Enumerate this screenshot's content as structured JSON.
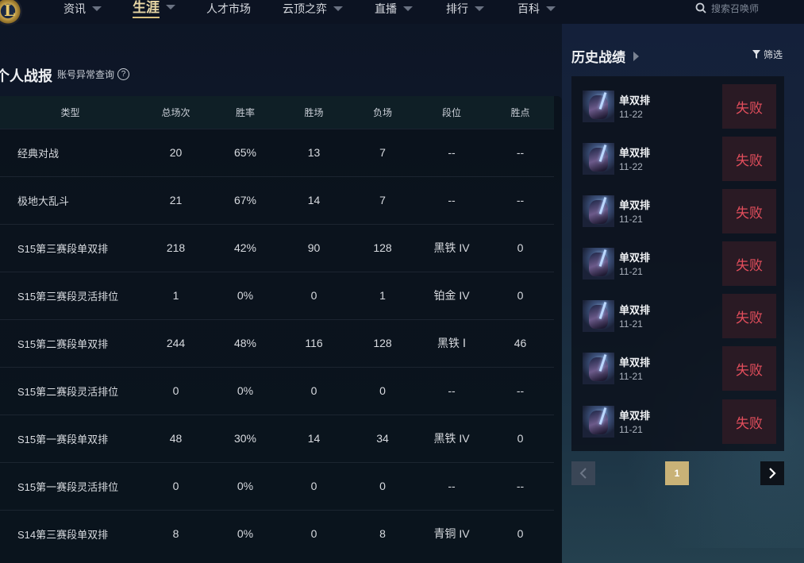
{
  "nav": {
    "items": [
      {
        "label": "资讯",
        "has_caret": true
      },
      {
        "label": "生涯",
        "has_caret": true,
        "active": true
      },
      {
        "label": "人才市场",
        "has_caret": false
      },
      {
        "label": "云顶之弈",
        "has_caret": true
      },
      {
        "label": "直播",
        "has_caret": true
      },
      {
        "label": "排行",
        "has_caret": true
      },
      {
        "label": "百科",
        "has_caret": true
      }
    ],
    "search_placeholder": "搜索召唤师"
  },
  "stats": {
    "title": "个人战报",
    "account_link": "账号异常查询",
    "help_icon": "?",
    "columns": [
      "类型",
      "总场次",
      "胜率",
      "胜场",
      "负场",
      "段位",
      "胜点"
    ],
    "rows": [
      [
        "经典对战",
        "20",
        "65%",
        "13",
        "7",
        "--",
        "--"
      ],
      [
        "极地大乱斗",
        "21",
        "67%",
        "14",
        "7",
        "--",
        "--"
      ],
      [
        "S15第三赛段单双排",
        "218",
        "42%",
        "90",
        "128",
        "黑铁 IV",
        "0"
      ],
      [
        "S15第三赛段灵活排位",
        "1",
        "0%",
        "0",
        "1",
        "铂金 IV",
        "0"
      ],
      [
        "S15第二赛段单双排",
        "244",
        "48%",
        "116",
        "128",
        "黑铁 Ⅰ",
        "46"
      ],
      [
        "S15第二赛段灵活排位",
        "0",
        "0%",
        "0",
        "0",
        "--",
        "--"
      ],
      [
        "S15第一赛段单双排",
        "48",
        "30%",
        "14",
        "34",
        "黑铁 IV",
        "0"
      ],
      [
        "S15第一赛段灵活排位",
        "0",
        "0%",
        "0",
        "0",
        "--",
        "--"
      ],
      [
        "S14第三赛段单双排",
        "8",
        "0%",
        "0",
        "8",
        "青铜 IV",
        "0"
      ]
    ]
  },
  "history": {
    "title": "历史战绩",
    "filter_label": "筛选",
    "matches": [
      {
        "mode": "单双排",
        "date": "11-22",
        "result": "失败"
      },
      {
        "mode": "单双排",
        "date": "11-22",
        "result": "失败"
      },
      {
        "mode": "单双排",
        "date": "11-21",
        "result": "失败"
      },
      {
        "mode": "单双排",
        "date": "11-21",
        "result": "失败"
      },
      {
        "mode": "单双排",
        "date": "11-21",
        "result": "失败"
      },
      {
        "mode": "单双排",
        "date": "11-21",
        "result": "失败"
      },
      {
        "mode": "单双排",
        "date": "11-21",
        "result": "失败"
      }
    ],
    "pagination": {
      "current_page": "1"
    }
  },
  "colors": {
    "accent_gold": "#c9b277",
    "loss_red": "#e24e5c",
    "active_nav": "#e8d7a5"
  }
}
